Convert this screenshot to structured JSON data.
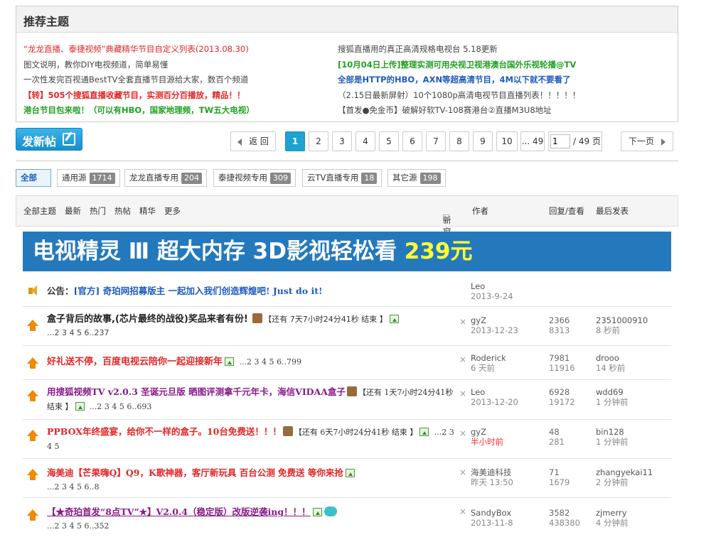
{
  "recommend": {
    "title": "推荐主题",
    "left": [
      {
        "text": "“龙龙直播、泰捷视频”典藏精华节目自定义列表(2013.08.30)",
        "cls": "c-red"
      },
      {
        "text": "图文说明，教你DIY电视频道，简单易懂",
        "cls": "c-gray"
      },
      {
        "text": "一次性发完百视通BestTV全套直播节目源给大家，数百个频道",
        "cls": "c-gray"
      },
      {
        "text": "【转】505个搜狐直播收藏节目，实测百分百播放，精品！！",
        "cls": "c-red"
      },
      {
        "text": "港台节目包来啦！（可以有HBO，国家地理频，TW五大电视）",
        "cls": "c-green"
      }
    ],
    "right": [
      {
        "text": "搜狐直播用的真正高清规格电视台 5.18更新",
        "cls": "c-gray"
      },
      {
        "text": "[10月04日上传]整理实测可用央视卫视港澳台国外乐视轮播@TV",
        "cls": "c-green"
      },
      {
        "text": "全部是HTTP的HBO，AXN等超高清节目，4M以下就不要看了",
        "cls": "c-blue"
      },
      {
        "text": "（2.15日最新屏射）10个1080p高清电视节目直播列表！！！！！",
        "cls": "c-gray"
      },
      {
        "text": "【首发●免金币】破解好软TV-108赛港台②直播M3U8地址",
        "cls": "c-gray"
      }
    ]
  },
  "toolbar": {
    "post_label": "发新帖",
    "back_label": "返 回",
    "pages": [
      "1",
      "2",
      "3",
      "4",
      "5",
      "6",
      "7",
      "8",
      "9",
      "10"
    ],
    "ellipsis_last": "... 49",
    "page_input_value": "1",
    "page_total": "/ 49 页",
    "next_label": "下一页"
  },
  "tabs": [
    {
      "label": "全部",
      "count": ""
    },
    {
      "label": "通用源",
      "count": "1714"
    },
    {
      "label": "龙龙直播专用",
      "count": "204"
    },
    {
      "label": "泰捷视频专用",
      "count": "309"
    },
    {
      "label": "云TV直播专用",
      "count": "18"
    },
    {
      "label": "其它源",
      "count": "198"
    }
  ],
  "list_header": {
    "filters": [
      "全部主题",
      "最新",
      "热门",
      "热帖",
      "精华",
      "更多"
    ],
    "new_window": "新窗",
    "author": "作者",
    "replies_views": "回复/查看",
    "last_post": "最后发表"
  },
  "banner": {
    "text": "电视精灵 Ⅲ 超大内存 3D影视轻松看",
    "price": "239元"
  },
  "threads": [
    {
      "type": "announce",
      "prefix": "公告：",
      "title": "[官方] 奇珀网招募版主 一起加入我们创造辉煌吧! Just do it!",
      "author": "Leo",
      "author_time": "2013-9-24"
    },
    {
      "title": "盒子背后的故事,(芯片最终的战役)奖品来者有份!",
      "note": "【还有 7天7小时24分41秒 结束 】",
      "pages": "...2 3 4 5 6..237",
      "author": "gyZ",
      "author_time": "2013-12-23",
      "replies": "2366",
      "views": "8313",
      "last_author": "2351000910",
      "last_time": "8 秒前"
    },
    {
      "title": "好礼送不停，百度电视云陪你一起迎接新年",
      "pages": "...2 3 4 5 6..799",
      "author": "Roderick",
      "author_time": "6 天前",
      "replies": "7981",
      "views": "11916",
      "last_author": "drooo",
      "last_time": "14 秒前"
    },
    {
      "title": "用搜狐视频TV v2.0.3 圣诞元旦版 晒图评测拿千元年卡，海信VIDAA盒子",
      "note": "【还有 1天7小时24分41秒 结束 】",
      "pages": "...2 3 4 5 6..693",
      "author": "Leo",
      "author_time": "2013-12-20",
      "replies": "6928",
      "views": "19172",
      "last_author": "wdd69",
      "last_time": "1 分钟前"
    },
    {
      "title": "PPBOX年终盛宴，给你不一样的盒子。10台免费送！！！",
      "note": "【还有 6天7小时24分41秒 结束 】",
      "pages": "...2 3 4 5",
      "author": "gyZ",
      "author_time": "半小时前",
      "replies": "48",
      "views": "281",
      "last_author": "bin128",
      "last_time": "1 分钟前"
    },
    {
      "title": "海美迪【芒果嗨Q】Q9，K歌神器，客厅新玩具 百台公测 免费送 等你来抢",
      "pages": "...2 3 4 5 6..8",
      "author": "海美迪科技",
      "author_time": "昨天 13:50",
      "replies": "71",
      "views": "1679",
      "last_author": "zhangyekai11",
      "last_time": "2 分钟前"
    },
    {
      "title": "【★奇珀首发“8点TV”★】V2.0.4（稳定版）改版逆袭ing！！！",
      "pages": "...2 3 4 5 6..352",
      "author": "SandyBox",
      "author_time": "2013-11-8",
      "replies": "3582",
      "views": "438380",
      "last_author": "zjmerry",
      "last_time": "4 分钟前"
    }
  ],
  "colors": {
    "accent": "#1ea2d4",
    "banner_bg": "#2479bd",
    "price": "#ffff33",
    "title_red": "#e32626",
    "title_purple": "#8a1a8a"
  }
}
